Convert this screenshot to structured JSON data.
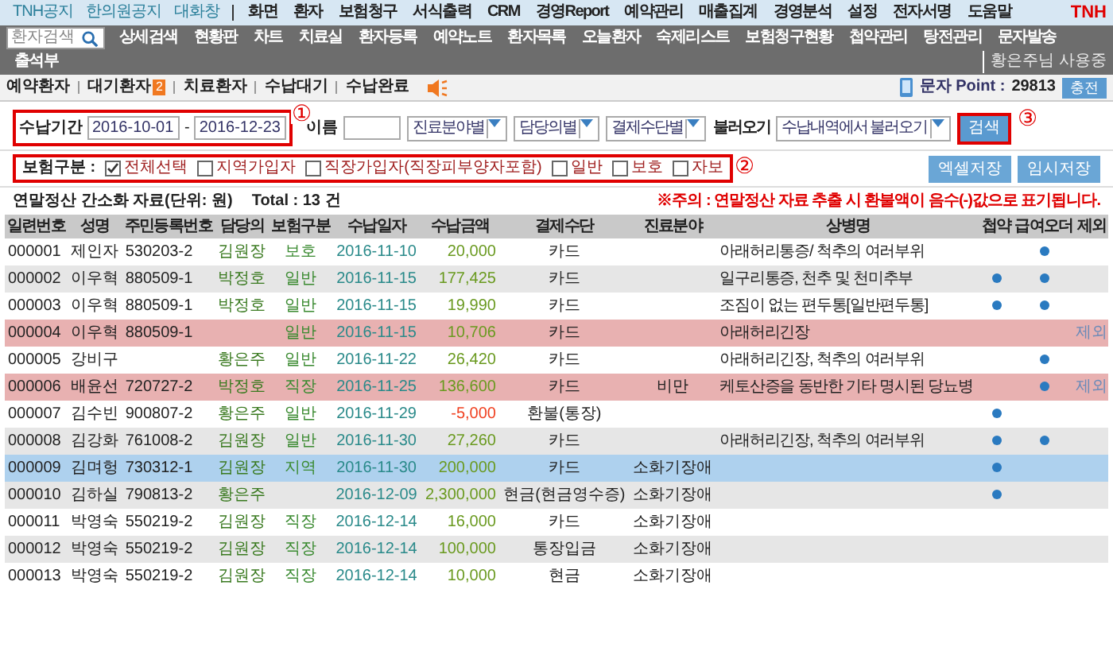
{
  "top_menu": {
    "links": [
      "TNH공지",
      "한의원공지",
      "대화창"
    ],
    "items": [
      "화면",
      "환자",
      "보험청구",
      "서식출력",
      "CRM",
      "경영Report",
      "예약관리",
      "매출집계",
      "경영분석",
      "설정",
      "전자서명",
      "도움말"
    ],
    "logo": "TNH"
  },
  "toolbar": {
    "search_placeholder": "환자검색",
    "items": [
      "상세검색",
      "현황판",
      "차트",
      "치료실",
      "환자등록",
      "예약노트",
      "환자목록",
      "오늘환자",
      "숙제리스트",
      "보험청구현황",
      "첩약관리",
      "탕전관리",
      "문자발송",
      "출석부"
    ],
    "user": "황은주님 사용중"
  },
  "queue_tabs": [
    {
      "label": "예약환자"
    },
    {
      "label": "대기환자",
      "badge": "2"
    },
    {
      "label": "치료환자"
    },
    {
      "label": "수납대기"
    },
    {
      "label": "수납완료"
    }
  ],
  "sms": {
    "label": "문자 Point :",
    "points": "29813",
    "button": "충전"
  },
  "filter": {
    "period_label": "수납기간",
    "from": "2016-10-01",
    "separator": "-",
    "to": "2016-12-23",
    "period_marker": "①",
    "name_label": "이름",
    "selects": [
      "진료분야별",
      "담당의별",
      "결제수단별"
    ],
    "load_label": "불러오기",
    "load_value": "수납내역에서 불러오기",
    "search_button": "검색",
    "search_marker": "③",
    "buttons": [
      "엑셀저장",
      "임시저장"
    ]
  },
  "insurance": {
    "label": "보험구분 :",
    "marker": "②",
    "options": [
      {
        "label": "전체선택",
        "checked": true
      },
      {
        "label": "지역가입자",
        "checked": false
      },
      {
        "label": "직장가입자(직장피부양자포함)",
        "checked": false
      },
      {
        "label": "일반",
        "checked": false
      },
      {
        "label": "보호",
        "checked": false
      },
      {
        "label": "자보",
        "checked": false
      }
    ]
  },
  "summary": {
    "title": "연말정산 간소화 자료(단위: 원)",
    "total": "Total : 13 건",
    "notice": "※주의 : 연말정산 자료 추출 시 환불액이 음수(-)값으로 표기됩니다."
  },
  "table": {
    "columns": [
      "일련번호",
      "성명",
      "주민등록번호",
      "담당의",
      "보험구분",
      "수납일자",
      "수납금액",
      "결제수단",
      "진료분야",
      "상병명",
      "첩약",
      "급여오더",
      "제외"
    ],
    "rows": [
      {
        "cells": [
          "000001",
          "제인자",
          "530203-2",
          "김원장",
          "보호",
          "2016-11-10",
          "20,000",
          "카드",
          "",
          "아래허리통증/ 척추의 여러부위"
        ],
        "herbal": false,
        "order": true,
        "excluded": false,
        "selected": false,
        "refund": false
      },
      {
        "cells": [
          "000002",
          "이우혁",
          "880509-1",
          "박정호",
          "일반",
          "2016-11-15",
          "177,425",
          "카드",
          "",
          "일구리통증, 천추 및 천미추부"
        ],
        "herbal": true,
        "order": true,
        "excluded": false,
        "selected": false,
        "refund": false
      },
      {
        "cells": [
          "000003",
          "이우혁",
          "880509-1",
          "박정호",
          "일반",
          "2016-11-15",
          "19,990",
          "카드",
          "",
          "조짐이 없는 편두통[일반편두통]"
        ],
        "herbal": true,
        "order": true,
        "excluded": false,
        "selected": false,
        "refund": false
      },
      {
        "cells": [
          "000004",
          "이우혁",
          "880509-1",
          "",
          "일반",
          "2016-11-15",
          "10,706",
          "카드",
          "",
          "아래허리긴장"
        ],
        "herbal": false,
        "order": false,
        "excluded": true,
        "exclude_label": "제외",
        "selected": false,
        "refund": false
      },
      {
        "cells": [
          "000005",
          "강비구",
          "",
          "황은주",
          "일반",
          "2016-11-22",
          "26,420",
          "카드",
          "",
          "아래허리긴장, 척추의 여러부위"
        ],
        "herbal": false,
        "order": true,
        "excluded": false,
        "selected": false,
        "refund": false
      },
      {
        "cells": [
          "000006",
          "배윤선",
          "720727-2",
          "박정호",
          "직장",
          "2016-11-25",
          "136,600",
          "카드",
          "비만",
          "케토산증을 동반한 기타 명시된 당뇨병"
        ],
        "herbal": false,
        "order": true,
        "excluded": true,
        "exclude_label": "제외",
        "selected": false,
        "refund": false
      },
      {
        "cells": [
          "000007",
          "김수빈",
          "900807-2",
          "황은주",
          "일반",
          "2016-11-29",
          "-5,000",
          "환불(통장)",
          "",
          ""
        ],
        "herbal": true,
        "order": false,
        "excluded": false,
        "selected": false,
        "refund": true
      },
      {
        "cells": [
          "000008",
          "김강화",
          "761008-2",
          "김원장",
          "일반",
          "2016-11-30",
          "27,260",
          "카드",
          "",
          "아래허리긴장, 척추의 여러부위"
        ],
        "herbal": true,
        "order": true,
        "excluded": false,
        "selected": false,
        "refund": false
      },
      {
        "cells": [
          "000009",
          "김며헝",
          "730312-1",
          "김원장",
          "지역",
          "2016-11-30",
          "200,000",
          "카드",
          "소화기장애",
          ""
        ],
        "herbal": true,
        "order": false,
        "excluded": false,
        "selected": true,
        "refund": false
      },
      {
        "cells": [
          "000010",
          "김하실",
          "790813-2",
          "황은주",
          "",
          "2016-12-09",
          "2,300,000",
          "현금(현금영수증)",
          "소화기장애",
          ""
        ],
        "herbal": true,
        "order": false,
        "excluded": false,
        "selected": false,
        "refund": false
      },
      {
        "cells": [
          "000011",
          "박영숙",
          "550219-2",
          "김원장",
          "직장",
          "2016-12-14",
          "16,000",
          "카드",
          "소화기장애",
          ""
        ],
        "herbal": false,
        "order": false,
        "excluded": false,
        "selected": false,
        "refund": false
      },
      {
        "cells": [
          "000012",
          "박영숙",
          "550219-2",
          "김원장",
          "직장",
          "2016-12-14",
          "100,000",
          "통장입금",
          "소화기장애",
          ""
        ],
        "herbal": false,
        "order": false,
        "excluded": false,
        "selected": false,
        "refund": false
      },
      {
        "cells": [
          "000013",
          "박영숙",
          "550219-2",
          "김원장",
          "직장",
          "2016-12-14",
          "10,000",
          "현금",
          "소화기장애",
          ""
        ],
        "herbal": false,
        "order": false,
        "excluded": false,
        "selected": false,
        "refund": false
      }
    ]
  }
}
